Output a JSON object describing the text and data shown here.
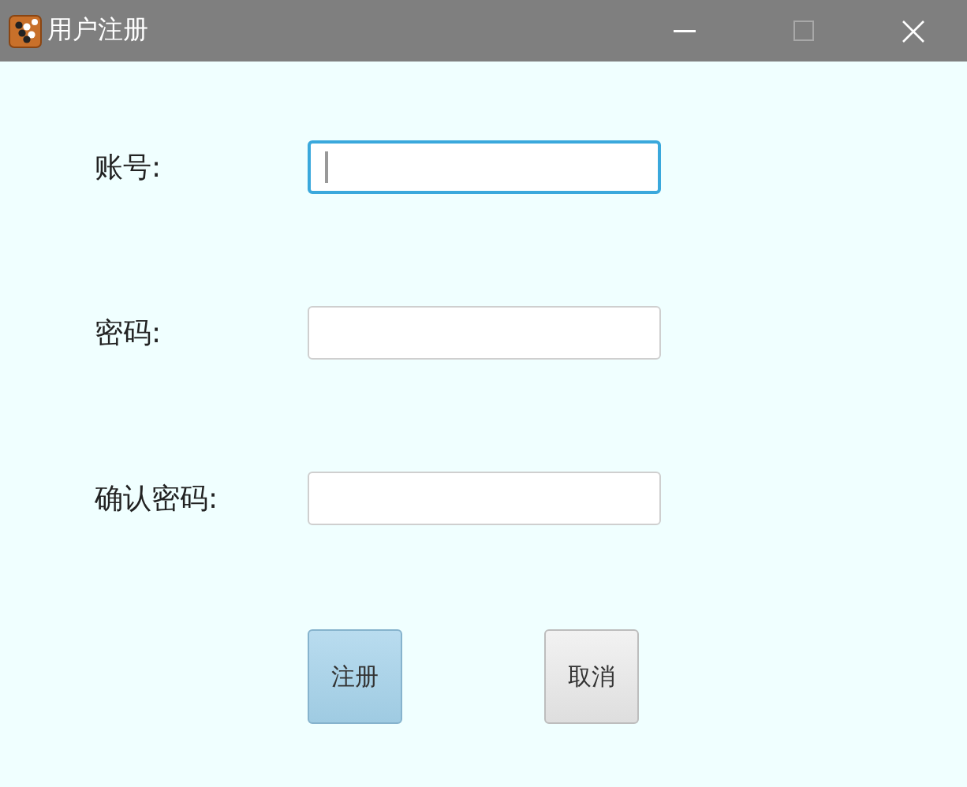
{
  "window": {
    "title": "用户注册"
  },
  "fields": [
    {
      "label": "账号:",
      "focused": true
    },
    {
      "label": "密码:",
      "focused": false
    },
    {
      "label": "确认密码:",
      "focused": false
    }
  ],
  "buttons": [
    {
      "label": "注册",
      "kind": "primary"
    },
    {
      "label": "取消",
      "kind": "default"
    }
  ]
}
